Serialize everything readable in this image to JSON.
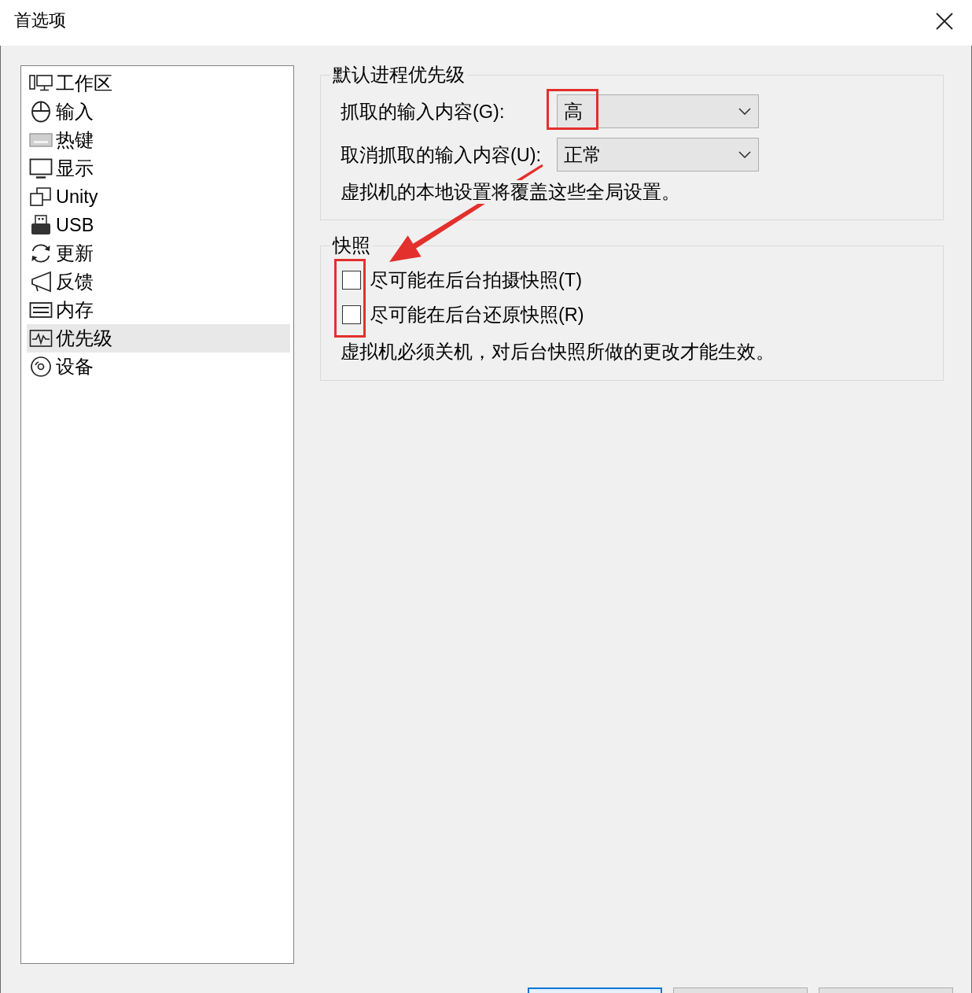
{
  "window": {
    "title": "首选项"
  },
  "sidebar": {
    "items": [
      {
        "label": "工作区",
        "selected": false
      },
      {
        "label": "输入",
        "selected": false
      },
      {
        "label": "热键",
        "selected": false
      },
      {
        "label": "显示",
        "selected": false
      },
      {
        "label": "Unity",
        "selected": false
      },
      {
        "label": "USB",
        "selected": false
      },
      {
        "label": "更新",
        "selected": false
      },
      {
        "label": "反馈",
        "selected": false
      },
      {
        "label": "内存",
        "selected": false
      },
      {
        "label": "优先级",
        "selected": true
      },
      {
        "label": "设备",
        "selected": false
      }
    ]
  },
  "priority": {
    "title": "默认进程优先级",
    "fields": [
      {
        "label": "抓取的输入内容(G):",
        "value": "高",
        "highlighted": true
      },
      {
        "label": "取消抓取的输入内容(U):",
        "value": "正常",
        "highlighted": false
      }
    ],
    "note": "虚拟机的本地设置将覆盖这些全局设置。"
  },
  "snapshot": {
    "title": "快照",
    "highlighted": true,
    "checkboxes": [
      {
        "label": "尽可能在后台拍摄快照(T)",
        "checked": false
      },
      {
        "label": "尽可能在后台还原快照(R)",
        "checked": false
      }
    ],
    "note": "虚拟机必须关机，对后台快照所做的更改才能生效。"
  },
  "annotation_arrow": true,
  "footer_buttons": [
    {
      "default": true
    },
    {
      "default": false
    },
    {
      "default": false
    }
  ]
}
